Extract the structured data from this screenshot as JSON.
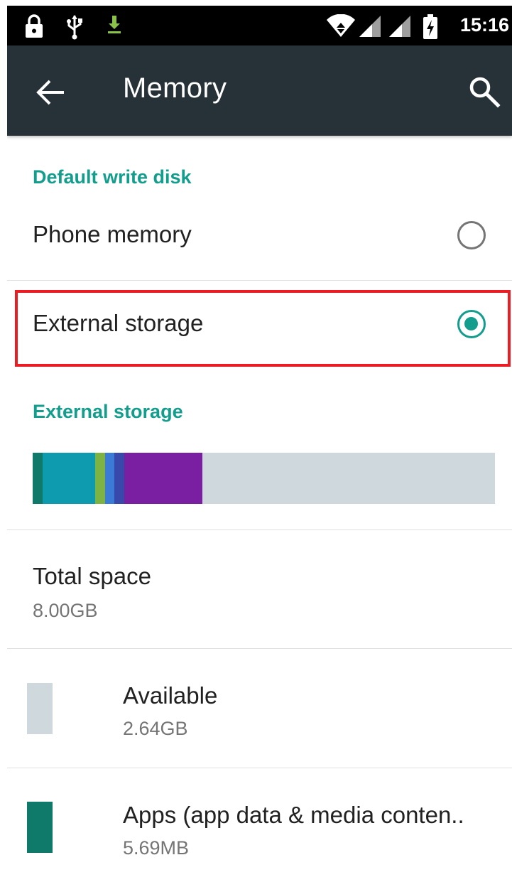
{
  "status_bar": {
    "time": "15:16",
    "icons": [
      "lock-icon",
      "usb-icon",
      "download-icon",
      "wifi-icon",
      "signal-icon",
      "signal-icon",
      "battery-charging-icon"
    ]
  },
  "app_bar": {
    "title": "Memory",
    "back_icon": "arrow-back-icon",
    "search_icon": "search-icon",
    "background": "#263238"
  },
  "default_write_disk": {
    "header": "Default write disk",
    "options": [
      {
        "label": "Phone memory",
        "selected": false
      },
      {
        "label": "External storage",
        "selected": true
      }
    ]
  },
  "external_storage": {
    "header": "External storage",
    "usage_bar": [
      {
        "name": "Apps (app data & media content)",
        "fraction": 0.021,
        "color": "#0f7a6a"
      },
      {
        "name": "segment-2",
        "fraction": 0.114,
        "color": "#0e9bb0"
      },
      {
        "name": "segment-3",
        "fraction": 0.021,
        "color": "#7cb342"
      },
      {
        "name": "segment-4",
        "fraction": 0.021,
        "color": "#3a7bd5"
      },
      {
        "name": "segment-5",
        "fraction": 0.021,
        "color": "#3949ab"
      },
      {
        "name": "segment-6",
        "fraction": 0.17,
        "color": "#7b1fa2"
      },
      {
        "name": "Available",
        "fraction": 0.632,
        "color": "#cfd8dc"
      }
    ],
    "total": {
      "label": "Total space",
      "value": "8.00GB"
    },
    "items": [
      {
        "label": "Available",
        "value": "2.64GB",
        "color": "#cfd8dc"
      },
      {
        "label": "Apps (app data & media conten..",
        "value": "5.69MB",
        "color": "#0f7a6a"
      }
    ]
  },
  "colors": {
    "accent": "#139d8c",
    "highlight": "#ec1c24"
  }
}
